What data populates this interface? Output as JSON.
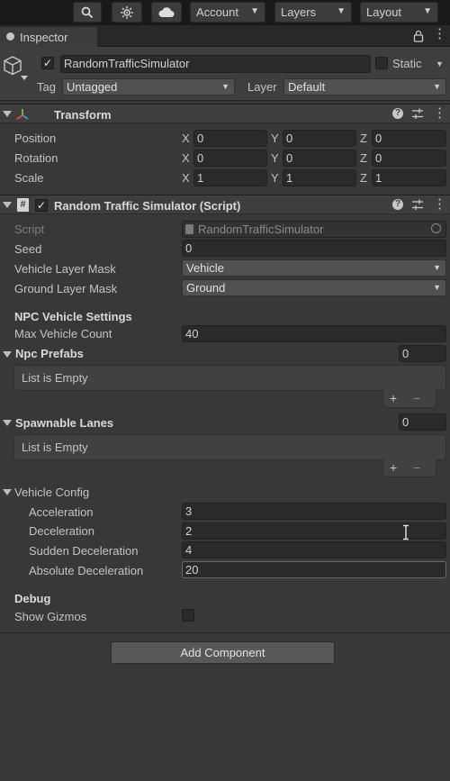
{
  "toolbar": {
    "account_label": "Account",
    "layers_label": "Layers",
    "layout_label": "Layout",
    "icons": [
      "search-icon",
      "collab-icon",
      "cloud-icon"
    ]
  },
  "tab": {
    "label": "Inspector"
  },
  "gameobject": {
    "name": "RandomTrafficSimulator",
    "active": true,
    "static_label": "Static",
    "tag_label": "Tag",
    "tag_value": "Untagged",
    "layer_label": "Layer",
    "layer_value": "Default"
  },
  "transform": {
    "title": "Transform",
    "rows": [
      {
        "label": "Position",
        "x": "0",
        "y": "0",
        "z": "0"
      },
      {
        "label": "Rotation",
        "x": "0",
        "y": "0",
        "z": "0"
      },
      {
        "label": "Scale",
        "x": "1",
        "y": "1",
        "z": "1"
      }
    ],
    "axis": {
      "x": "X",
      "y": "Y",
      "z": "Z"
    }
  },
  "script": {
    "title": "Random Traffic Simulator (Script)",
    "enabled": true,
    "script_label": "Script",
    "script_value": "RandomTrafficSimulator",
    "seed_label": "Seed",
    "seed_value": "0",
    "vehicle_mask_label": "Vehicle Layer Mask",
    "vehicle_mask_value": "Vehicle",
    "ground_mask_label": "Ground Layer Mask",
    "ground_mask_value": "Ground",
    "npc_header": "NPC Vehicle Settings",
    "max_count_label": "Max Vehicle Count",
    "max_count_value": "40",
    "npc_prefabs_label": "Npc Prefabs",
    "npc_prefabs_count": "0",
    "list_empty": "List is Empty",
    "spawnable_label": "Spawnable Lanes",
    "spawnable_count": "0",
    "vehicle_config_label": "Vehicle Config",
    "acceleration_label": "Acceleration",
    "acceleration_value": "3",
    "deceleration_label": "Deceleration",
    "deceleration_value": "2",
    "sudden_label": "Sudden Deceleration",
    "sudden_value": "4",
    "absolute_label": "Absolute Deceleration",
    "absolute_value": "20",
    "debug_header": "Debug",
    "gizmos_label": "Show Gizmos",
    "gizmos_value": false
  },
  "add_component_label": "Add Component",
  "colors": {
    "background": "#383838",
    "field": "#2a2a2a",
    "header": "#3e3e3e"
  }
}
